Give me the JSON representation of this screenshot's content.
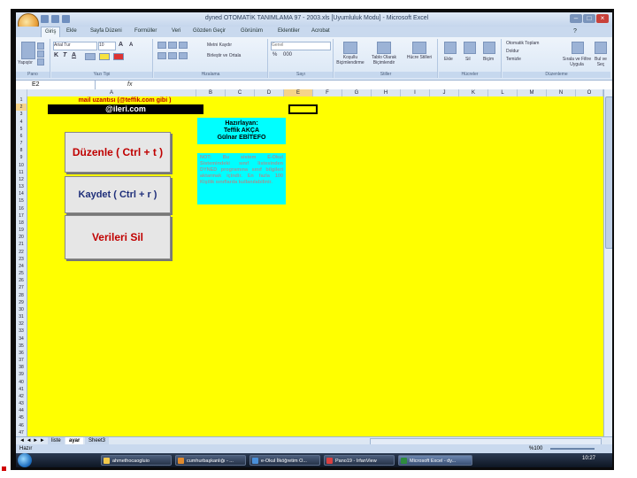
{
  "window": {
    "title": "dyned OTOMATİK TANIMLAMA 97 - 2003.xls [Uyumluluk Modu] - Microsoft Excel"
  },
  "ribbon": {
    "tabs": [
      "Giriş",
      "Ekle",
      "Sayfa Düzeni",
      "Formüller",
      "Veri",
      "Gözden Geçir",
      "Görünüm",
      "Eklentiler",
      "Acrobat"
    ],
    "active_tab": "Giriş",
    "groups": {
      "pano": {
        "label": "Pano",
        "paste": "Yapıştır"
      },
      "font": {
        "label": "Yazı Tipi",
        "font_name": "Arial Tur",
        "font_size": "10"
      },
      "align": {
        "label": "Hizalama",
        "wrap": "Metni Kaydır",
        "merge": "Birleştir ve Ortala"
      },
      "number": {
        "label": "Sayı",
        "format": "Genel"
      },
      "styles": {
        "label": "Stiller",
        "cond": "Koşullu Biçimlendirme",
        "table": "Tablo Olarak Biçimlendir",
        "cell": "Hücre Stilleri"
      },
      "cells": {
        "label": "Hücreler",
        "insert": "Ekle",
        "delete": "Sil",
        "format": "Biçim"
      },
      "edit": {
        "label": "Düzenleme",
        "autosum": "Otomatik Toplam",
        "fill": "Doldur",
        "clear": "Temizle",
        "sort": "Sırala ve Filtre Uygula",
        "find": "Bul ve Seç"
      }
    }
  },
  "formula_bar": {
    "name_box": "E2",
    "fx": "fx",
    "value": ""
  },
  "columns": [
    "A",
    "B",
    "C",
    "D",
    "E",
    "F",
    "G",
    "H",
    "I",
    "J",
    "K",
    "L",
    "M",
    "N",
    "O"
  ],
  "rows": [
    "1",
    "2",
    "3",
    "4",
    "5",
    "6",
    "7",
    "8",
    "9",
    "10",
    "11",
    "12",
    "13",
    "14",
    "15",
    "16",
    "17",
    "18",
    "19",
    "20",
    "21",
    "22",
    "23",
    "24",
    "25",
    "26",
    "27",
    "28",
    "29",
    "30",
    "31",
    "32",
    "33",
    "34",
    "35",
    "36",
    "37",
    "38",
    "39",
    "40",
    "41",
    "42",
    "43",
    "44",
    "45",
    "46",
    "47"
  ],
  "sheet": {
    "mail_text": "mail uzantısı (@teffik.com gibi )",
    "domain_text": "@ileri.com",
    "buttons": {
      "edit": "Düzenle  ( Ctrl + t )",
      "save": "Kaydet ( Ctrl + r )",
      "delete": "Verileri Sil"
    },
    "author": {
      "heading": "Hazırlayan:",
      "name1": "Teffik AKÇA",
      "name2": "Gülnar EBİTEFO"
    },
    "note": "NOT: Bu sistem E-Okul Sistemindeki sınıf listesinden DYNED programına sınıf bilgileri aktarmak içindir. En fazla 100 Kişilik sınıflarda kullanılabilinir."
  },
  "sheet_tabs": [
    "liste",
    "ayar",
    "Sheet3"
  ],
  "status": {
    "mode": "Hazır",
    "zoom": "%100"
  },
  "taskbar": {
    "items": [
      "ahmethocaogluio",
      "cumhurbaşkanlığı - ...",
      "e-Okul İlköğretim O...",
      "Pano19 - IrfanView",
      "Microsoft Excel - dy..."
    ],
    "clock": "10:27"
  },
  "colors": {
    "sheet_bg": "#ffff00",
    "accent_cyan": "#00ffff",
    "red_text": "#c00000"
  }
}
